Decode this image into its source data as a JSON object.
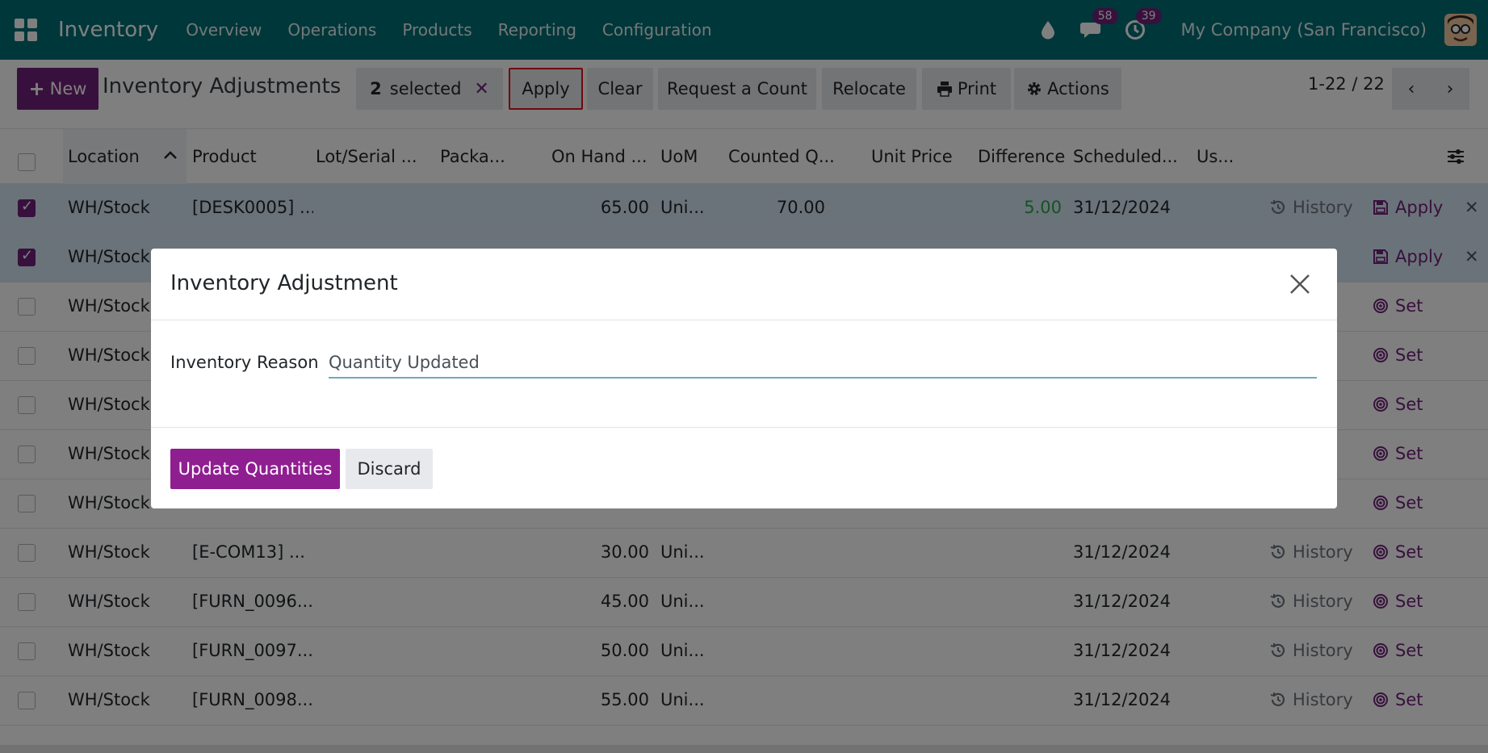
{
  "navbar": {
    "brand": "Inventory",
    "menu": [
      "Overview",
      "Operations",
      "Products",
      "Reporting",
      "Configuration"
    ],
    "messages_badge": "58",
    "activities_badge": "39",
    "company": "My Company (San Francisco)"
  },
  "control": {
    "new_label": "New",
    "title": "Inventory Adjustments",
    "selected_count": "2",
    "selected_label": "selected",
    "apply_label": "Apply",
    "clear_label": "Clear",
    "request_count_label": "Request a Count",
    "relocate_label": "Relocate",
    "print_label": "Print",
    "actions_label": "Actions",
    "pager": "1-22 / 22"
  },
  "table": {
    "columns": [
      "Location",
      "Product",
      "Lot/Serial ...",
      "Packa...",
      "On Hand ...",
      "UoM",
      "Counted Q...",
      "Unit Price",
      "Difference",
      "Scheduled...",
      "Us..."
    ],
    "rows": [
      {
        "location": "WH/Stock",
        "product": "[DESK0005] ...",
        "on_hand": "65.00",
        "uom": "Uni...",
        "counted": "70.00",
        "difference": "5.00",
        "scheduled": "31/12/2024",
        "history": "History",
        "action": "Apply",
        "selected": true
      },
      {
        "location": "WH/Stock",
        "product": "",
        "on_hand": "",
        "uom": "",
        "counted": "",
        "difference": "",
        "scheduled": "",
        "history": "",
        "action": "Apply",
        "selected": true
      },
      {
        "location": "WH/Stock",
        "product": "",
        "on_hand": "",
        "uom": "",
        "counted": "",
        "difference": "",
        "scheduled": "",
        "history": "",
        "action": "Set",
        "selected": false
      },
      {
        "location": "WH/Stock",
        "product": "",
        "on_hand": "",
        "uom": "",
        "counted": "",
        "difference": "",
        "scheduled": "",
        "history": "",
        "action": "Set",
        "selected": false
      },
      {
        "location": "WH/Stock",
        "product": "",
        "on_hand": "",
        "uom": "",
        "counted": "",
        "difference": "",
        "scheduled": "",
        "history": "",
        "action": "Set",
        "selected": false
      },
      {
        "location": "WH/Stock",
        "product": "",
        "on_hand": "",
        "uom": "",
        "counted": "",
        "difference": "",
        "scheduled": "",
        "history": "",
        "action": "Set",
        "selected": false
      },
      {
        "location": "WH/Stock",
        "product": "",
        "on_hand": "",
        "uom": "",
        "counted": "",
        "difference": "",
        "scheduled": "",
        "history": "",
        "action": "Set",
        "selected": false
      },
      {
        "location": "WH/Stock",
        "product": "[E-COM13] ...",
        "on_hand": "30.00",
        "uom": "Uni...",
        "counted": "",
        "difference": "",
        "scheduled": "31/12/2024",
        "history": "History",
        "action": "Set",
        "selected": false
      },
      {
        "location": "WH/Stock",
        "product": "[FURN_0096...",
        "on_hand": "45.00",
        "uom": "Uni...",
        "counted": "",
        "difference": "",
        "scheduled": "31/12/2024",
        "history": "History",
        "action": "Set",
        "selected": false
      },
      {
        "location": "WH/Stock",
        "product": "[FURN_0097...",
        "on_hand": "50.00",
        "uom": "Uni...",
        "counted": "",
        "difference": "",
        "scheduled": "31/12/2024",
        "history": "History",
        "action": "Set",
        "selected": false
      },
      {
        "location": "WH/Stock",
        "product": "[FURN_0098...",
        "on_hand": "55.00",
        "uom": "Uni...",
        "counted": "",
        "difference": "",
        "scheduled": "31/12/2024",
        "history": "History",
        "action": "Set",
        "selected": false
      }
    ]
  },
  "modal": {
    "title": "Inventory Adjustment",
    "field_label": "Inventory Reason",
    "field_value": "Quantity Updated",
    "primary_label": "Update Quantities",
    "discard_label": "Discard"
  },
  "colors": {
    "navbar": "#016e75",
    "primary": "#71217a",
    "selected_row": "#d4e6f3",
    "highlight_border": "#e0101f",
    "difference_positive": "#28a745"
  }
}
